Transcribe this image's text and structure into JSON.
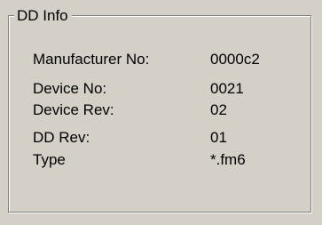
{
  "group": {
    "title": "DD Info"
  },
  "fields": [
    {
      "label": "Manufacturer No:",
      "value": "0000c2"
    },
    {
      "label": "Device No:",
      "value": "0021"
    },
    {
      "label": "Device Rev:",
      "value": "02"
    },
    {
      "label": "DD Rev:",
      "value": "01"
    },
    {
      "label": "Type",
      "value": "*.fm6"
    }
  ]
}
